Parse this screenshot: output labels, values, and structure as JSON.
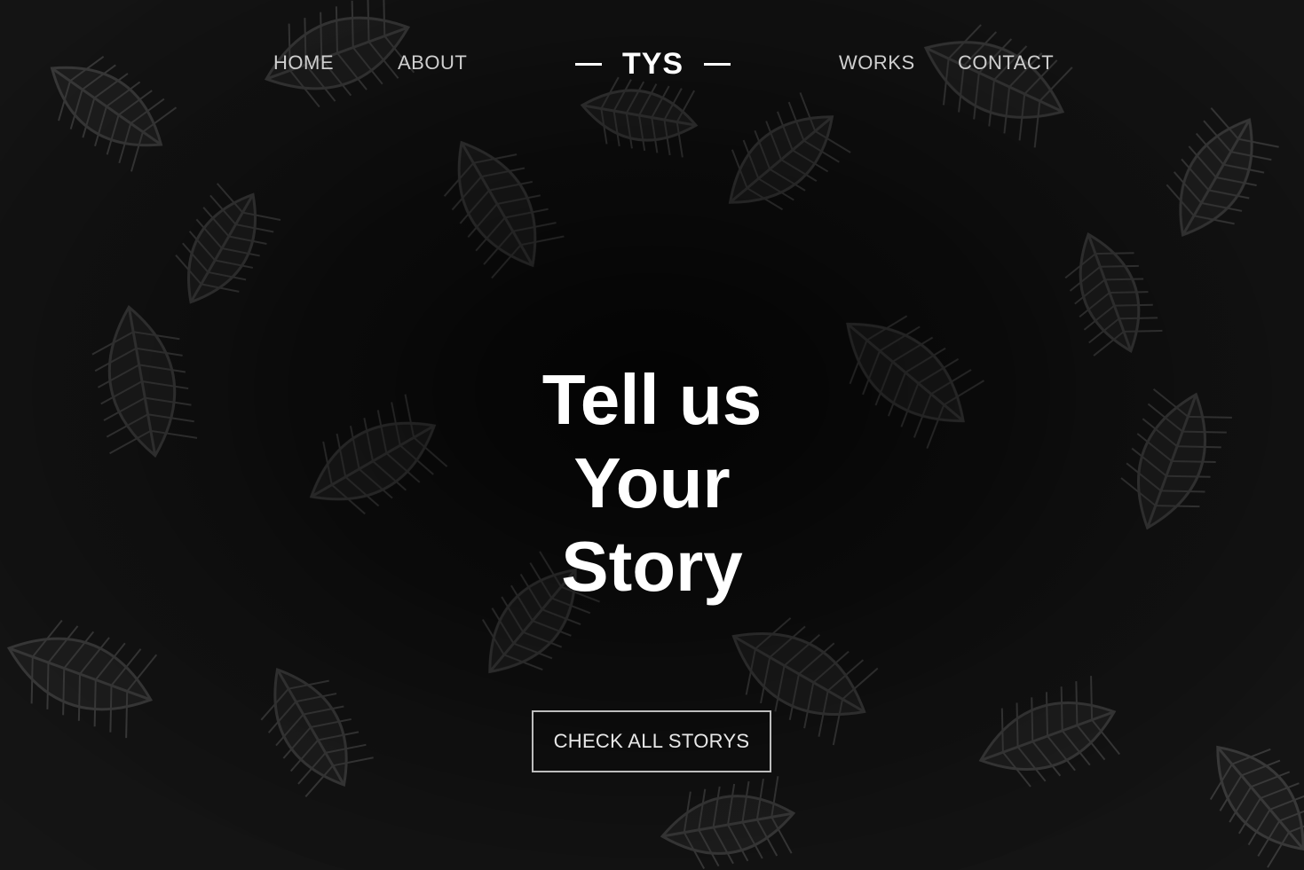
{
  "brand": {
    "logo_text": "TYS"
  },
  "nav": {
    "left": [
      {
        "label": "HOME"
      },
      {
        "label": "ABOUT"
      }
    ],
    "right": [
      {
        "label": "WORKS"
      },
      {
        "label": "CONTACT"
      }
    ]
  },
  "hero": {
    "headline_lines": [
      "Tell us",
      "Your",
      "Story"
    ],
    "cta_label": "CHECK ALL STORYS",
    "background_image": "leaf-pattern-image"
  },
  "colors": {
    "background": "#151515",
    "leaf_vein": "#3a3a3a",
    "text_primary": "#ffffff",
    "nav_text": "#cfcfcf",
    "cta_border": "#bdbdbd"
  }
}
